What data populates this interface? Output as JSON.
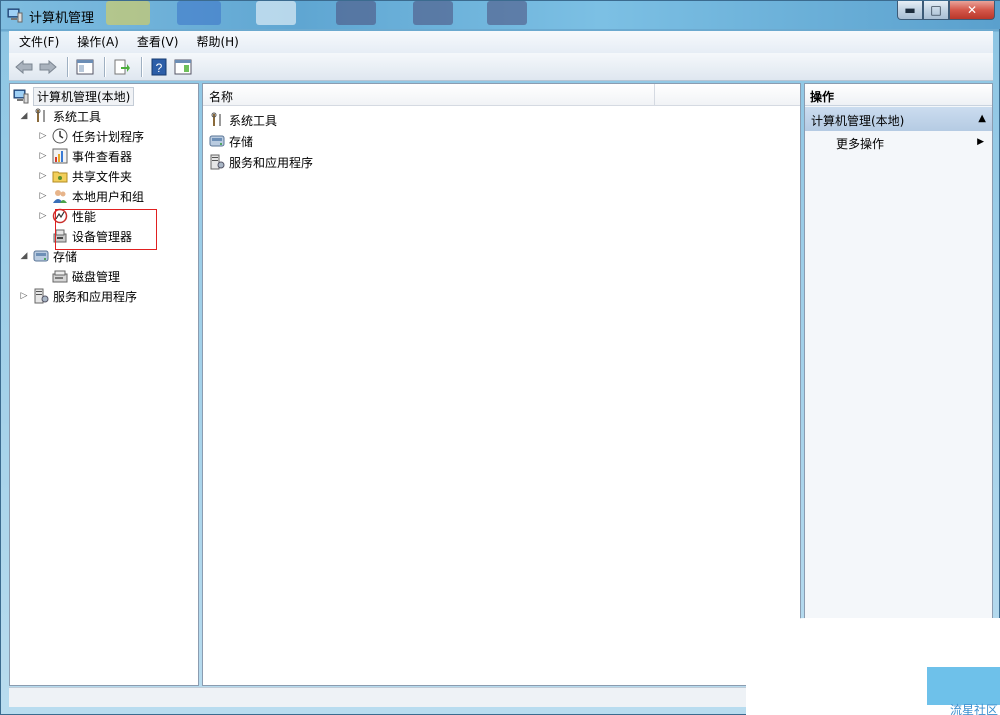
{
  "window": {
    "title": "计算机管理"
  },
  "menubar": {
    "items": [
      "文件(F)",
      "操作(A)",
      "查看(V)",
      "帮助(H)"
    ]
  },
  "tree": {
    "root": "计算机管理(本地)",
    "system_tools": "系统工具",
    "task_scheduler": "任务计划程序",
    "event_viewer": "事件查看器",
    "shared_folders": "共享文件夹",
    "local_users": "本地用户和组",
    "performance": "性能",
    "device_manager": "设备管理器",
    "storage": "存储",
    "disk_management": "磁盘管理",
    "services_apps": "服务和应用程序"
  },
  "list": {
    "column_name": "名称",
    "items": [
      "系统工具",
      "存储",
      "服务和应用程序"
    ]
  },
  "actions": {
    "header": "操作",
    "section": "计算机管理(本地)",
    "more": "更多操作"
  },
  "watermark": {
    "text": "流星社区"
  },
  "colors": {
    "titlebar": "#6aa9cf",
    "selection": "#b5cbe3",
    "highlight_box": "#e02020"
  }
}
